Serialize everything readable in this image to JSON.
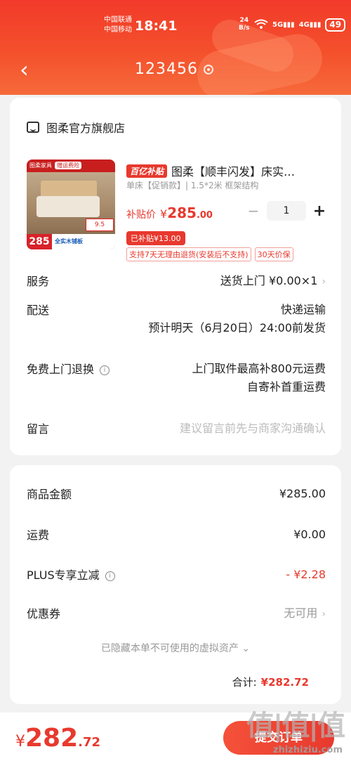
{
  "status_bar": {
    "carrier1": "中国联通",
    "carrier2": "中国移动",
    "time": "18:41",
    "speed_value": "24",
    "speed_unit": "B/s",
    "sig1": "5G",
    "sig2": "4G",
    "battery": "49"
  },
  "nav": {
    "title": "123456",
    "back_icon": "chevron-left-icon",
    "location_icon": "location-icon"
  },
  "shop": {
    "name": "图柔官方旗舰店"
  },
  "product": {
    "promo_badge": "百亿补贴",
    "title": "图柔【顺丰闪发】床实…",
    "spec": "单床【促销款】| 1.5*2米 框架结构",
    "price_label": "补贴价",
    "price_currency": "¥",
    "price_int": "285",
    "price_dec": ".00",
    "quantity": "1",
    "subsidy_tag": "已补贴¥13.00",
    "tags": [
      "支持7天无理由退货(安装后不支持)",
      "30天价保"
    ],
    "thumb": {
      "brand": "图柔家具",
      "badge": "赠运费险",
      "sale": "9.5",
      "price": "285",
      "strip": "全实木铺板"
    }
  },
  "details": {
    "service_label": "服务",
    "service_value": "送货上门 ¥0.00×1",
    "delivery_label": "配送",
    "delivery_value1": "快递运输",
    "delivery_value2": "预计明天（6月20日）24:00前发货",
    "return_label": "免费上门退换",
    "return_value1": "上门取件最高补800元运费",
    "return_value2": "自寄补首重运费",
    "message_label": "留言",
    "message_placeholder": "建议留言前先与商家沟通确认"
  },
  "summary": {
    "goods_label": "商品金额",
    "goods_value": "¥285.00",
    "shipping_label": "运费",
    "shipping_value": "¥0.00",
    "plus_label": "PLUS专享立减",
    "plus_value": "- ¥2.28",
    "coupon_label": "优惠券",
    "coupon_value": "无可用",
    "hidden_assets": "已隐藏本单不可使用的虚拟资产",
    "total_label": "合计:",
    "total_value": "¥282.72"
  },
  "bottom_bar": {
    "currency": "¥",
    "price_int": "282",
    "price_dec": ".72",
    "submit_label": "提交订单"
  },
  "watermark": {
    "text": "值|值|值",
    "site": "zhizhiziu.com"
  },
  "colors": {
    "accent": "#e8392e",
    "header": "#f4502c"
  }
}
